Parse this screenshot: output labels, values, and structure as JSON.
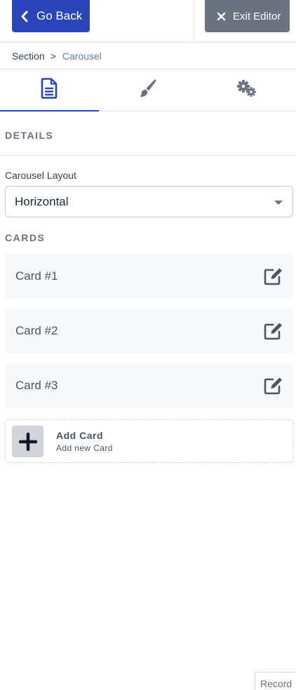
{
  "header": {
    "go_back_label": "Go Back",
    "exit_editor_label": "Exit Editor",
    "go_back_color": "#2a45b9",
    "exit_editor_color": "#6b7280"
  },
  "breadcrumb": {
    "parent": "Section",
    "separator": ">",
    "current": "Carousel"
  },
  "tabs": [
    {
      "icon": "document-icon",
      "active": true
    },
    {
      "icon": "brush-icon",
      "active": false
    },
    {
      "icon": "gears-icon",
      "active": false
    }
  ],
  "details": {
    "heading": "DETAILS",
    "layout_label": "Carousel Layout",
    "layout_value": "Horizontal"
  },
  "cards": {
    "heading": "CARDS",
    "items": [
      {
        "label": "Card #1",
        "icon": "edit-icon"
      },
      {
        "label": "Card #2",
        "icon": "edit-icon"
      },
      {
        "label": "Card #3",
        "icon": "edit-icon"
      }
    ],
    "add": {
      "title": "Add Card",
      "subtitle": "Add new Card",
      "icon": "plus-icon"
    }
  },
  "footer": {
    "record_label": "Record"
  }
}
